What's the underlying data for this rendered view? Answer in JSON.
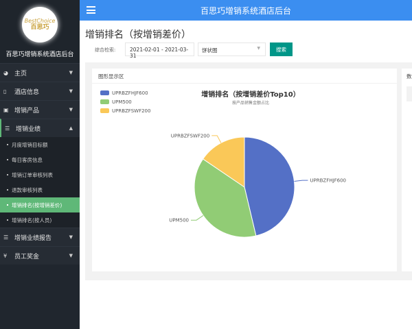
{
  "sidebar": {
    "logo_text": "BestChoice 百思巧",
    "title": "百思巧增销系统酒店后台",
    "items": [
      {
        "label": "主页",
        "icon": "dashboard-icon"
      },
      {
        "label": "酒店信息",
        "icon": "tablet-icon"
      },
      {
        "label": "增销产品",
        "icon": "book-icon"
      },
      {
        "label": "增销业绩",
        "icon": "sliders-icon",
        "expanded": true,
        "children": [
          "月度增销目标额",
          "每日客房信息",
          "增销订单审核列表",
          "退款审核列表",
          "增销排名(按增销差价)",
          "增销排名(按人员)"
        ],
        "active_child": 4
      },
      {
        "label": "增销业绩报告",
        "icon": "sliders-icon"
      },
      {
        "label": "员工奖金",
        "icon": "yen-icon"
      }
    ]
  },
  "topbar": {
    "title": "百思巧增销系统酒店后台"
  },
  "page": {
    "title": "增销排名（按增销差价）"
  },
  "search": {
    "label": "综合检索:",
    "date_range": "2021-02-01 - 2021-03-31",
    "chart_type": "饼状图",
    "button": "搜索"
  },
  "panel": {
    "title": "图形显示区"
  },
  "panel2": {
    "title": "数"
  },
  "chart_data": {
    "type": "pie",
    "title": "增销排名（按增销差价Top10）",
    "subtitle": "按产品销售金额占比",
    "legend_position": "top-left",
    "categories": [
      "UPRBZFHJF600",
      "UPM500",
      "UPRBZFSWF200"
    ],
    "values": [
      46.3,
      38.2,
      15.5
    ],
    "colors": [
      "#5470c6",
      "#91cc75",
      "#fac858"
    ]
  }
}
